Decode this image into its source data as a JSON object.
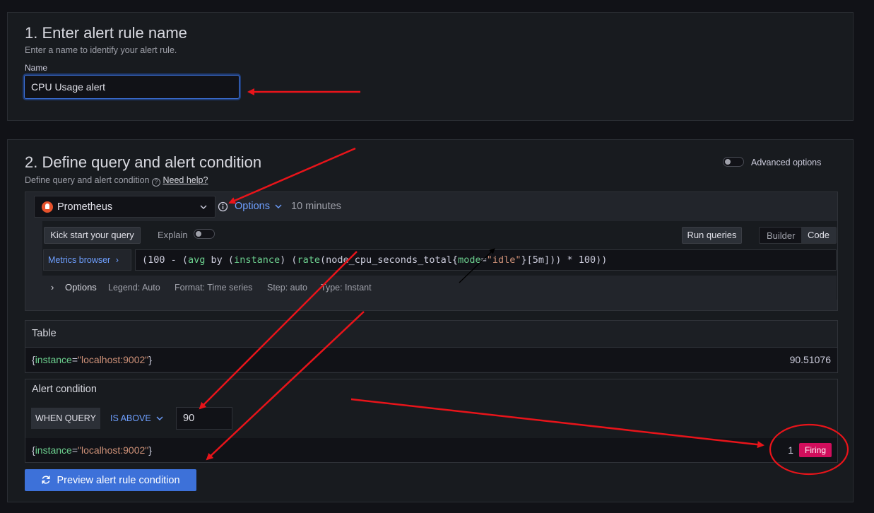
{
  "section1": {
    "title": "1. Enter alert rule name",
    "subtitle": "Enter a name to identify your alert rule.",
    "name_label": "Name",
    "name_value": "CPU Usage alert"
  },
  "section2": {
    "title": "2. Define query and alert condition",
    "subtitle": "Define query and alert condition",
    "help_link": "Need help?",
    "advanced_options_label": "Advanced options",
    "datasource": {
      "name": "Prometheus"
    },
    "options_label": "Options",
    "time_range": "10 minutes",
    "kick_start_label": "Kick start your query",
    "explain_label": "Explain",
    "run_queries_label": "Run queries",
    "mode_builder": "Builder",
    "mode_code": "Code",
    "metrics_browser_label": "Metrics browser",
    "query": {
      "p1": "(100 - (",
      "fn_avg": "avg",
      "p2": " by (",
      "instance_kw": "instance",
      "p3": ") (",
      "fn_rate": "rate",
      "p4": "(node_cpu_seconds_total{",
      "mode_kw": "mode",
      "p5": "=",
      "idle_str": "\"idle\"",
      "p6": "}[5m])) * 100))"
    },
    "query_options": {
      "label": "Options",
      "legend": "Legend: Auto",
      "format": "Format: Time series",
      "step": "Step: auto",
      "type": "Type: Instant"
    },
    "table": {
      "title": "Table",
      "row_label_open": "{",
      "row_label_name": "instance",
      "row_label_eq": "=",
      "row_label_value": "\"localhost:9002\"",
      "row_label_close": "}",
      "row_value": "90.51076"
    },
    "alert_condition": {
      "title": "Alert condition",
      "when_query": "WHEN QUERY",
      "operator": "IS ABOVE",
      "threshold": "90",
      "row_label_open": "{",
      "row_label_name": "instance",
      "row_label_eq": "=",
      "row_label_value": "\"localhost:9002\"",
      "row_label_close": "}",
      "result_count": "1",
      "state": "Firing"
    },
    "preview_button_label": "Preview alert rule condition"
  },
  "colors": {
    "background": "#111217",
    "panel": "#181b1f",
    "accent_blue": "#3d71d9",
    "firing": "#d10e5c",
    "annotation_red": "#e8141a"
  }
}
